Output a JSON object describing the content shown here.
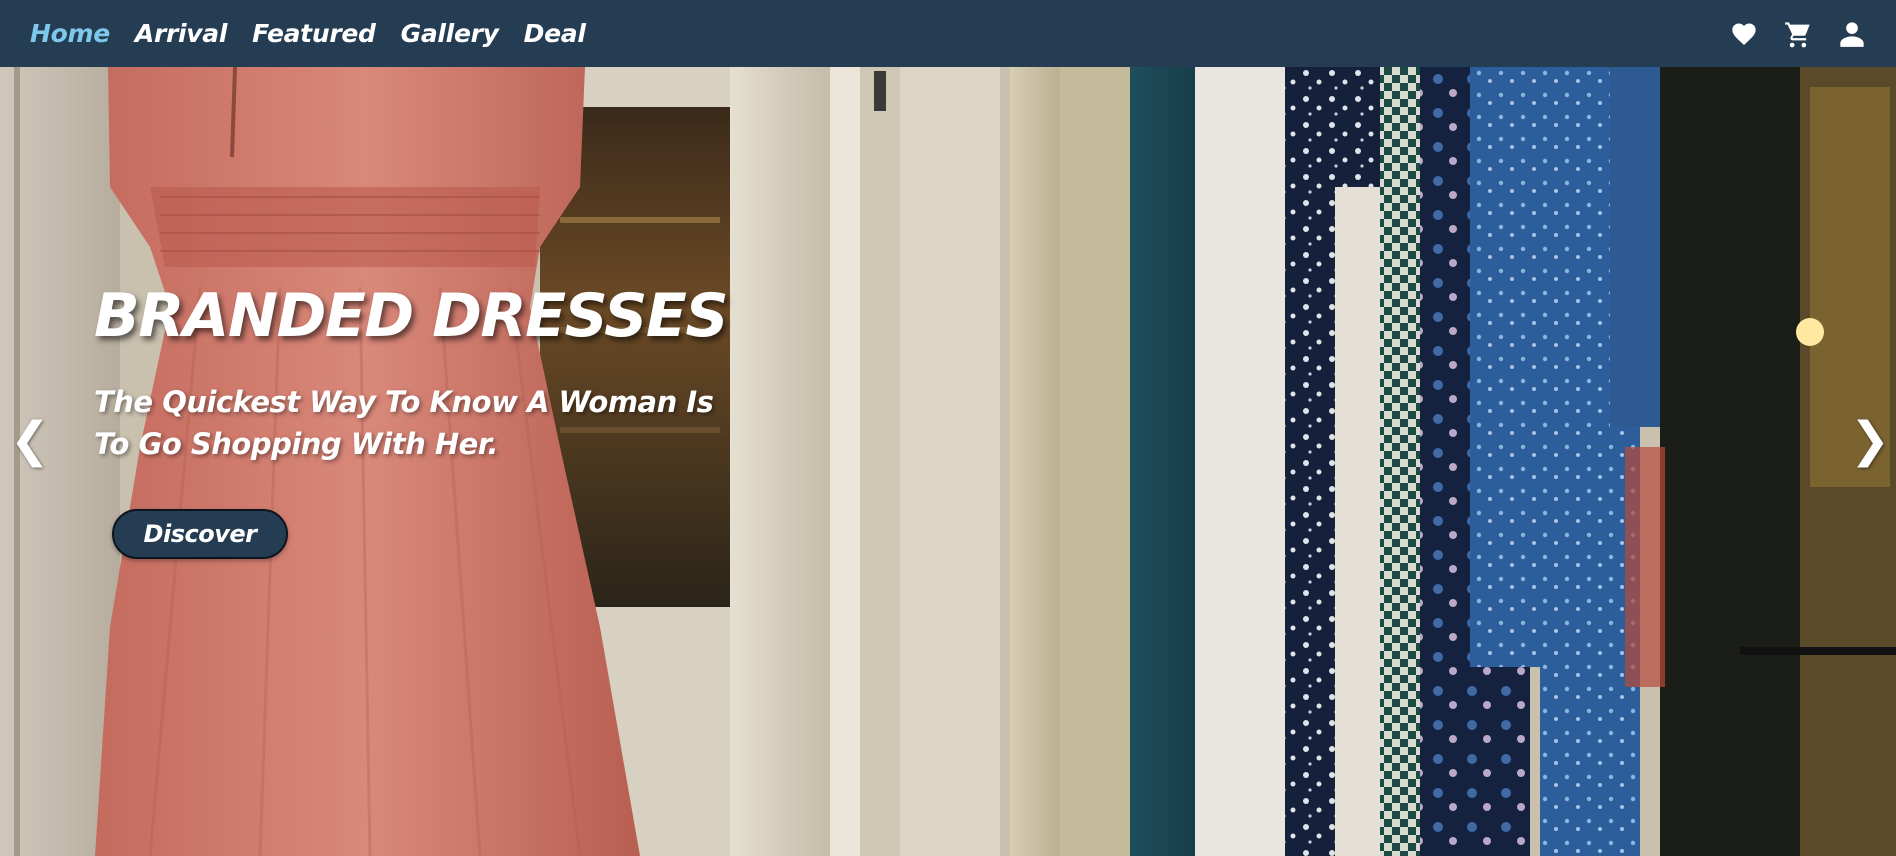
{
  "nav": {
    "links": [
      {
        "label": "Home",
        "active": true
      },
      {
        "label": "Arrival",
        "active": false
      },
      {
        "label": "Featured",
        "active": false
      },
      {
        "label": "Gallery",
        "active": false
      },
      {
        "label": "Deal",
        "active": false
      }
    ],
    "icons": [
      "heart-icon",
      "cart-icon",
      "user-icon"
    ]
  },
  "hero": {
    "title": "BRANDED DRESSES",
    "subtitle": "The Quickest Way To Know A Woman Is To Go Shopping With Her.",
    "button_label": "Discover",
    "prev_arrow": "❮",
    "next_arrow": "❯"
  },
  "colors": {
    "navbar_bg": "#253d53",
    "active_link": "#7ec8ec",
    "button_bg": "#253d53",
    "text": "#ffffff"
  }
}
